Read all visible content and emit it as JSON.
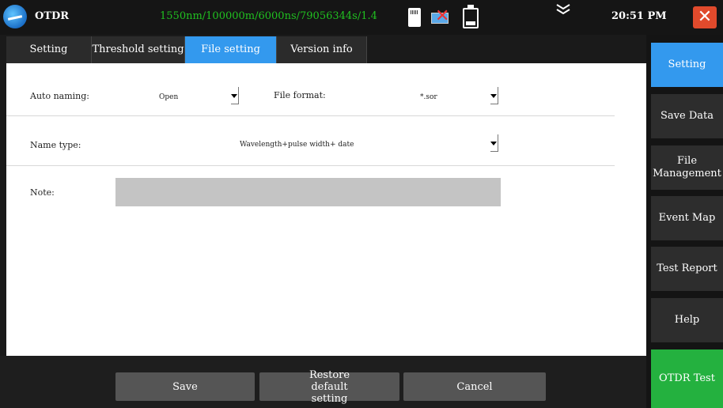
{
  "titlebar": {
    "app_title": "OTDR",
    "status_text": "1550nm/100000m/6000ns/79056344s/1.4",
    "clock": "20:51 PM",
    "close_symbol": "✕",
    "icons": [
      "sd-card-icon",
      "usb-disconnected-icon",
      "battery-icon",
      "chevron-down-icon",
      "close-icon"
    ]
  },
  "tabs": [
    {
      "label": "Setting",
      "active": false
    },
    {
      "label": "Threshold setting",
      "active": false
    },
    {
      "label": "File setting",
      "active": true
    },
    {
      "label": "Version info",
      "active": false
    }
  ],
  "form": {
    "auto_naming_label": "Auto naming:",
    "auto_naming_value": "Open",
    "file_format_label": "File format:",
    "file_format_value": "*.sor",
    "name_type_label": "Name type:",
    "name_type_value": "Wavelength+pulse width+ date",
    "note_label": "Note:",
    "note_value": ""
  },
  "sidebar": {
    "items": [
      {
        "label": "Setting",
        "active": true
      },
      {
        "label": "Save Data"
      },
      {
        "label": "File Management"
      },
      {
        "label": "Event Map"
      },
      {
        "label": "Test Report"
      },
      {
        "label": "Help"
      },
      {
        "label": "OTDR Test",
        "accent": true
      }
    ]
  },
  "bottom": {
    "save_label": "Save",
    "restore_label": "Restore default setting",
    "cancel_label": "Cancel"
  },
  "colors": {
    "accent_blue": "#3399ee",
    "status_green": "#20c020",
    "otdr_test_green": "#24b13f",
    "close_red": "#e04a2c"
  }
}
